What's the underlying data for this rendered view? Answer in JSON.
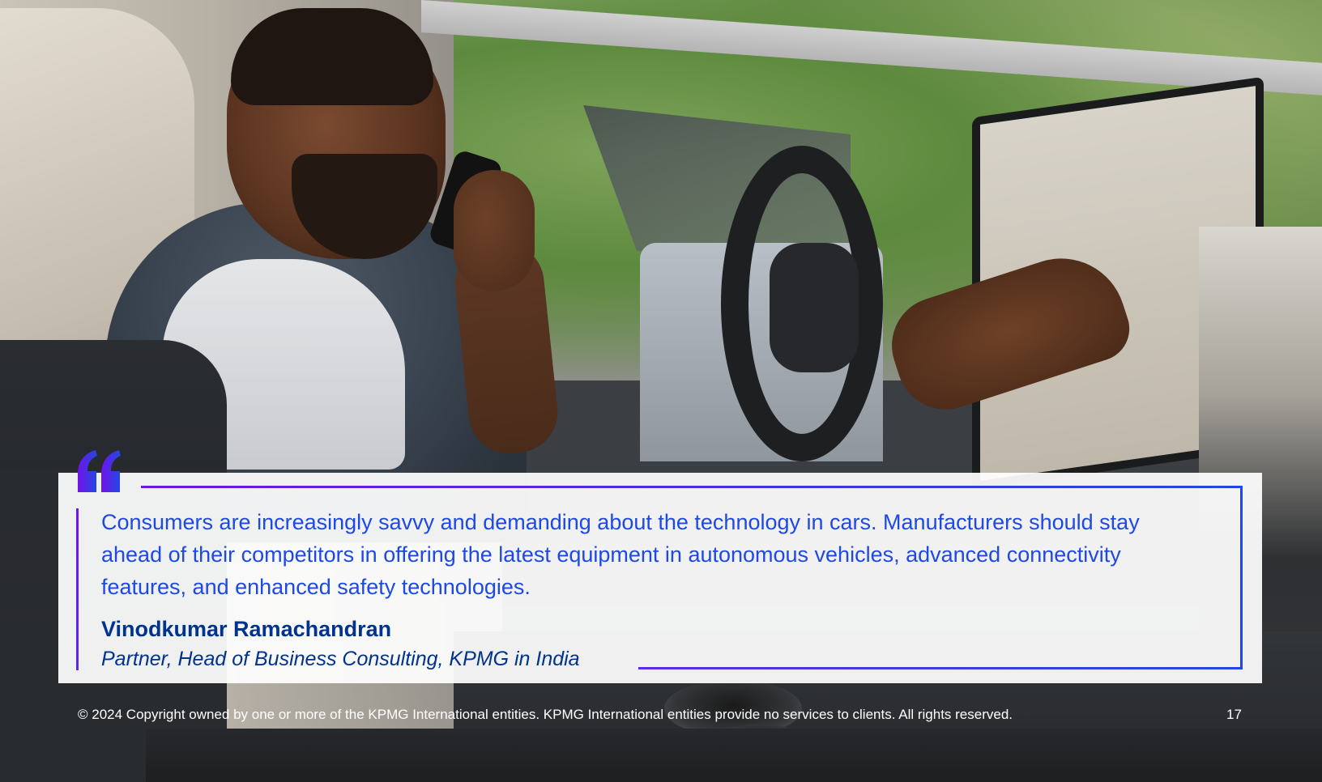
{
  "quote": {
    "text": "Consumers are increasingly savvy and demanding about the technology in cars. Manufacturers should stay ahead of their competitors in offering the latest equipment in autonomous vehicles, advanced connectivity features, and enhanced safety technologies.",
    "author_name": "Vinodkumar Ramachandran",
    "author_role": "Partner, Head of Business Consulting, KPMG in India"
  },
  "footer": {
    "copyright": "© 2024 Copyright owned by one or more of the KPMG International entities. KPMG International entities provide no services to clients. All rights reserved.",
    "page_number": "17"
  },
  "colors": {
    "text_blue": "#1e49e2",
    "name_navy": "#00338d",
    "accent_purple": "#7213ea",
    "footer_text": "#ffffff"
  },
  "icons": {
    "quote_mark": "open-quote-icon"
  }
}
